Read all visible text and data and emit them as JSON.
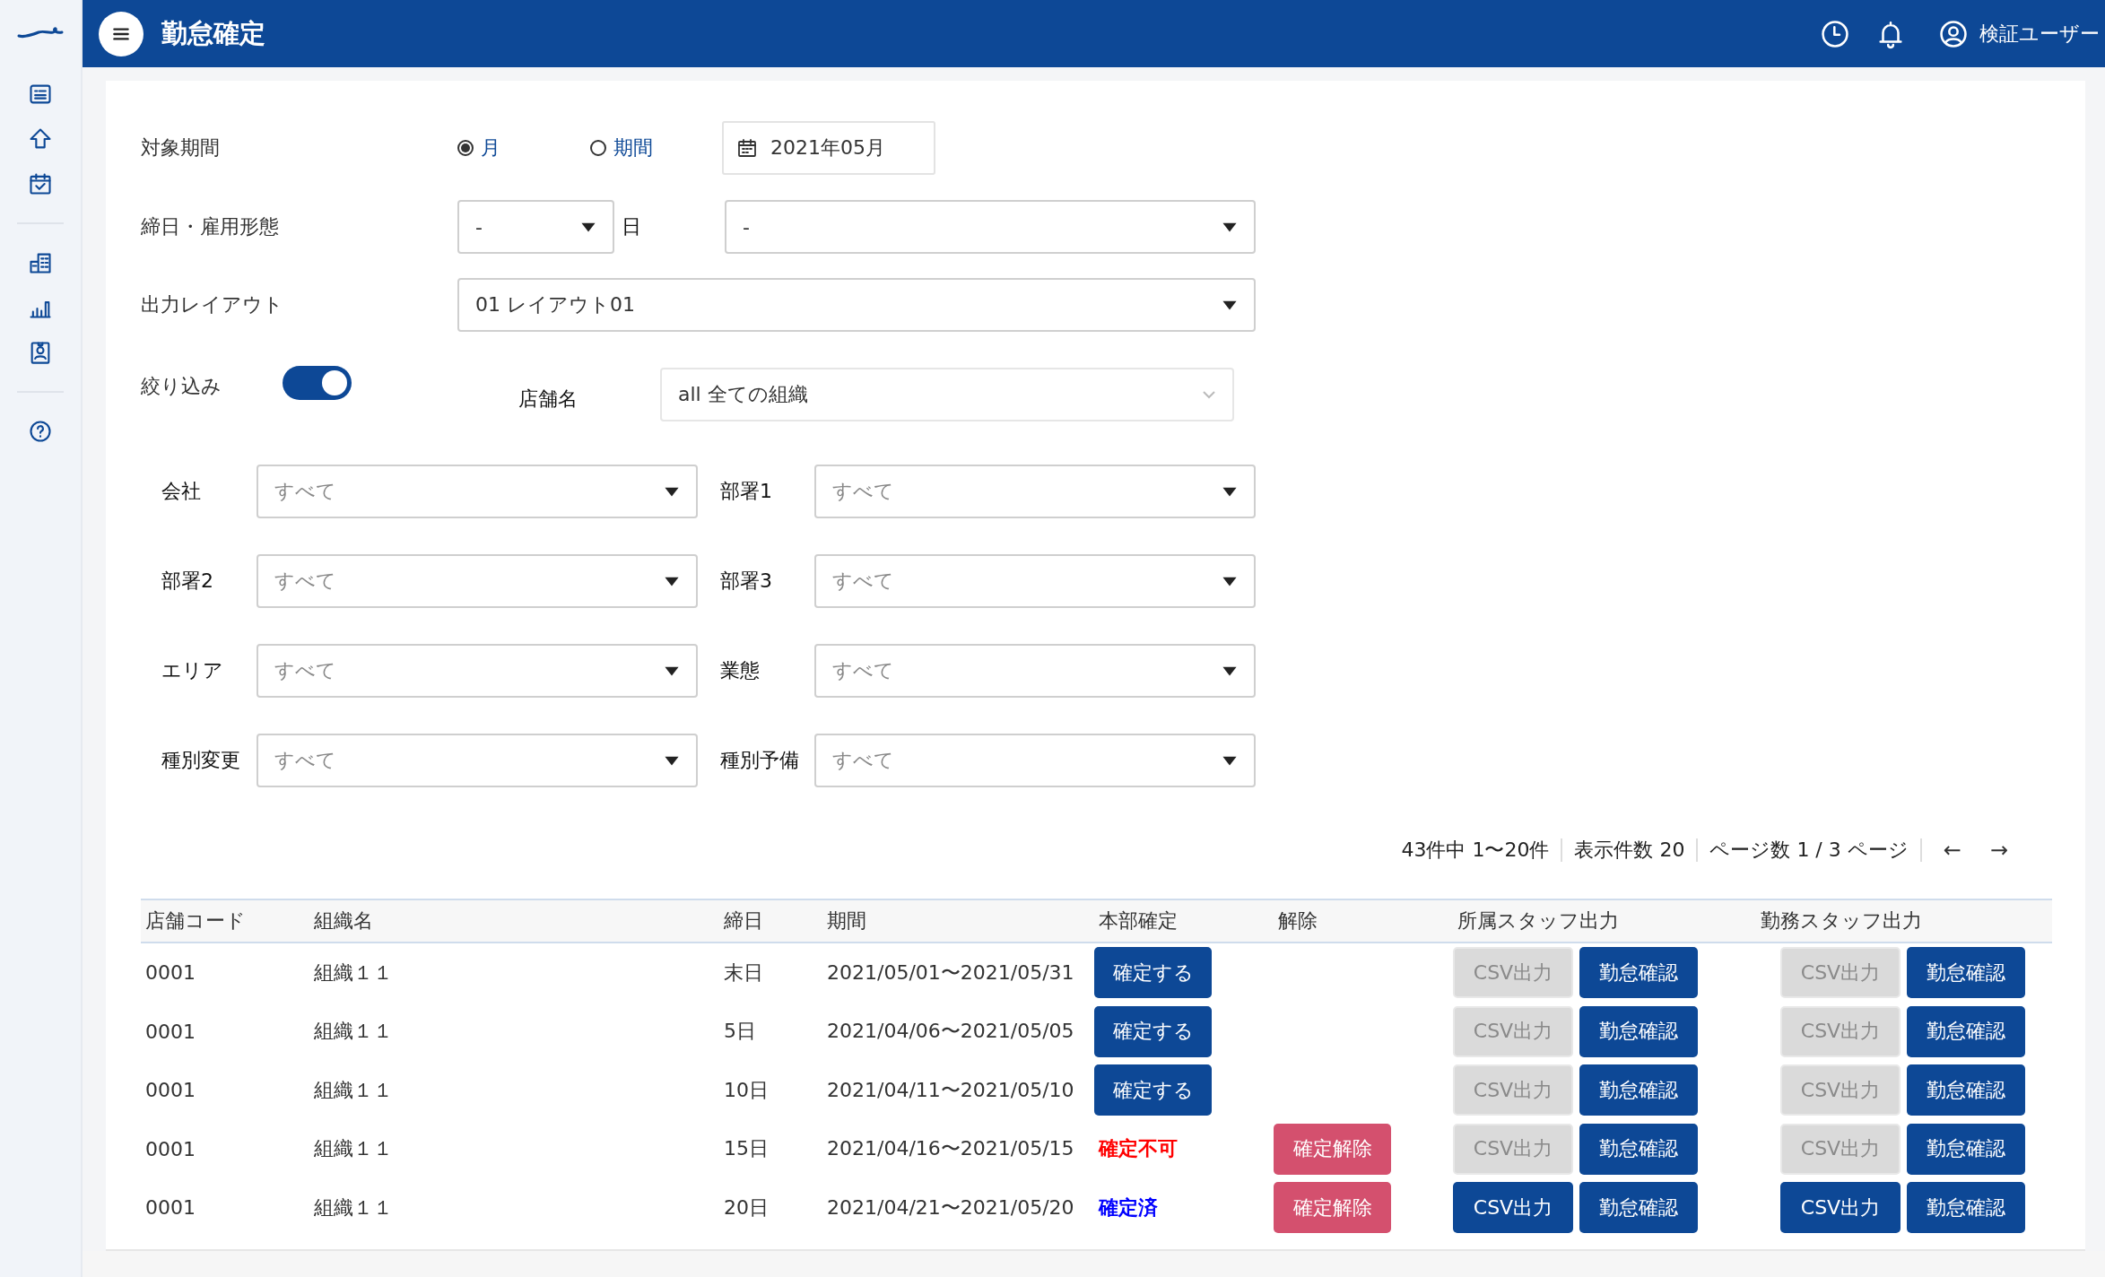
{
  "header": {
    "title": "勤怠確定",
    "user": "検証ユーザー"
  },
  "form": {
    "period": {
      "label": "対象期間",
      "options": [
        {
          "label": "月",
          "selected": true
        },
        {
          "label": "期間",
          "selected": false
        }
      ],
      "date": "2021年05月"
    },
    "closing": {
      "label": "締日・雇用形態",
      "day_value": "-",
      "day_suffix": "日",
      "type_value": "-"
    },
    "layout": {
      "label": "出力レイアウト",
      "value": "01 レイアウト01"
    },
    "filter": {
      "label": "絞り込み",
      "on": true,
      "store_label": "店舗名",
      "store_value": "all 全ての組織"
    },
    "fields": [
      {
        "label": "会社",
        "placeholder": "すべて"
      },
      {
        "label": "部署1",
        "placeholder": "すべて"
      },
      {
        "label": "部署2",
        "placeholder": "すべて"
      },
      {
        "label": "部署3",
        "placeholder": "すべて"
      },
      {
        "label": "エリア",
        "placeholder": "すべて"
      },
      {
        "label": "業態",
        "placeholder": "すべて"
      },
      {
        "label": "種別変更",
        "placeholder": "すべて"
      },
      {
        "label": "種別予備",
        "placeholder": "すべて"
      }
    ]
  },
  "pagination": {
    "summary": "43件中 1〜20件",
    "per_page": "表示件数 20",
    "pages": "ページ数 1 / 3 ページ",
    "prev": "←",
    "next": "→"
  },
  "table": {
    "columns": [
      "店舗コード",
      "組織名",
      "締日",
      "期間",
      "本部確定",
      "解除",
      "所属スタッフ出力",
      "勤務スタッフ出力"
    ],
    "rows": [
      {
        "code": "0001",
        "name": "組織１１",
        "closing": "末日",
        "period": "2021/05/01〜2021/05/31",
        "hq": {
          "kind": "button",
          "text": "確定する"
        },
        "staff_export": [
          {
            "text": "CSV出力",
            "disabled": true
          },
          {
            "text": "勤怠確認",
            "disabled": false
          }
        ],
        "work_export": [
          {
            "text": "CSV出力",
            "disabled": true
          },
          {
            "text": "勤怠確認",
            "disabled": false
          }
        ]
      },
      {
        "code": "0001",
        "name": "組織１１",
        "closing": "5日",
        "period": "2021/04/06〜2021/05/05",
        "hq": {
          "kind": "button",
          "text": "確定する"
        },
        "staff_export": [
          {
            "text": "CSV出力",
            "disabled": true
          },
          {
            "text": "勤怠確認",
            "disabled": false
          }
        ],
        "work_export": [
          {
            "text": "CSV出力",
            "disabled": true
          },
          {
            "text": "勤怠確認",
            "disabled": false
          }
        ]
      },
      {
        "code": "0001",
        "name": "組織１１",
        "closing": "10日",
        "period": "2021/04/11〜2021/05/10",
        "hq": {
          "kind": "button",
          "text": "確定する"
        },
        "staff_export": [
          {
            "text": "CSV出力",
            "disabled": true
          },
          {
            "text": "勤怠確認",
            "disabled": false
          }
        ],
        "work_export": [
          {
            "text": "CSV出力",
            "disabled": true
          },
          {
            "text": "勤怠確認",
            "disabled": false
          }
        ]
      },
      {
        "code": "0001",
        "name": "組織１１",
        "closing": "15日",
        "period": "2021/04/16〜2021/05/15",
        "hq": {
          "kind": "ng",
          "text": "確定不可"
        },
        "release": "確定解除",
        "staff_export": [
          {
            "text": "CSV出力",
            "disabled": true
          },
          {
            "text": "勤怠確認",
            "disabled": false
          }
        ],
        "work_export": [
          {
            "text": "CSV出力",
            "disabled": true
          },
          {
            "text": "勤怠確認",
            "disabled": false
          }
        ]
      },
      {
        "code": "0001",
        "name": "組織１１",
        "closing": "20日",
        "period": "2021/04/21〜2021/05/20",
        "hq": {
          "kind": "done",
          "text": "確定済"
        },
        "release": "確定解除",
        "staff_export": [
          {
            "text": "CSV出力",
            "disabled": false
          },
          {
            "text": "勤怠確認",
            "disabled": false
          }
        ],
        "work_export": [
          {
            "text": "CSV出力",
            "disabled": false
          },
          {
            "text": "勤怠確認",
            "disabled": false
          }
        ]
      }
    ]
  }
}
